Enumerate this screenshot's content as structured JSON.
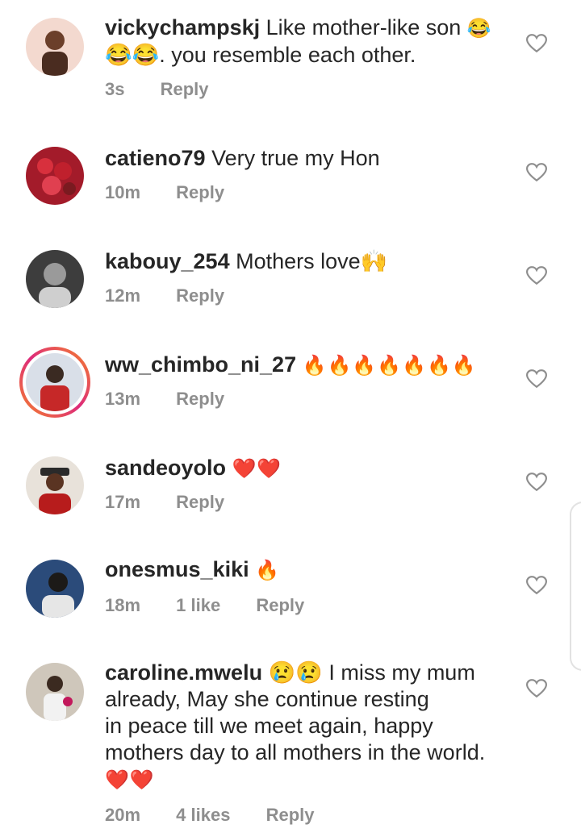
{
  "comments": [
    {
      "user": "vickychampskj",
      "text": "Like mother-like son",
      "emoji_mid": "😂",
      "text2": "😂😂. you resemble each other.",
      "time": "3s",
      "likes": "",
      "reply": "Reply",
      "avatar_color": "#8a5a3c"
    },
    {
      "user": "catieno79",
      "text": "Very true my Hon",
      "time": "10m",
      "likes": "",
      "reply": "Reply",
      "avatar_color": "#a31b2a"
    },
    {
      "user": "kabouy_254",
      "text": "Mothers love🙌",
      "time": "12m",
      "likes": "",
      "reply": "Reply",
      "avatar_color": "#555555"
    },
    {
      "user": "ww_chimbo_ni_27",
      "text": "🔥🔥🔥🔥🔥🔥🔥",
      "time": "13m",
      "likes": "",
      "reply": "Reply",
      "avatar_color": "#c62828"
    },
    {
      "user": "sandeoyolo",
      "text": "❤️❤️",
      "time": "17m",
      "likes": "",
      "reply": "Reply",
      "avatar_color": "#8b1e1e"
    },
    {
      "user": "onesmus_kiki",
      "text": "🔥",
      "time": "18m",
      "likes": "1 like",
      "reply": "Reply",
      "avatar_color": "#2b4b7a"
    },
    {
      "user": "caroline.mwelu",
      "text": "😢😢 I miss my mum",
      "text_lines": [
        "already, May she continue resting",
        "in peace till we meet again, happy",
        "mothers day to all mothers in the world.",
        "❤️❤️"
      ],
      "time": "20m",
      "likes": "4 likes",
      "reply": "Reply",
      "avatar_color": "#7a6a5a"
    }
  ],
  "icons": {
    "like": "heart-outline-icon"
  }
}
